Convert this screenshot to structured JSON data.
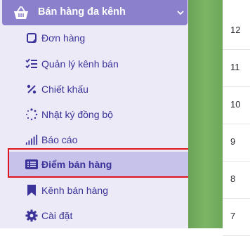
{
  "sidebar": {
    "header": {
      "icon": "basket-icon",
      "title": "Bán hàng đa kênh",
      "chevron": "chevron-down-icon"
    },
    "items": [
      {
        "label": "Đơn hàng",
        "icon": "order-icon"
      },
      {
        "label": "Quản lý kênh bán",
        "icon": "checklist-icon"
      },
      {
        "label": "Chiết khấu",
        "icon": "percent-icon"
      },
      {
        "label": "Nhật ký đồng bộ",
        "icon": "sync-log-icon"
      },
      {
        "label": "Báo cáo",
        "icon": "bar-chart-icon"
      },
      {
        "label": "Điểm bán hàng",
        "icon": "list-icon",
        "active": true
      },
      {
        "label": "Kênh bán hàng",
        "icon": "bookmark-icon"
      },
      {
        "label": "Cài đặt",
        "icon": "gear-icon"
      }
    ]
  },
  "table": {
    "values": [
      "12",
      "11",
      "10",
      "9",
      "8",
      "7"
    ]
  },
  "colors": {
    "header_bg": "#8a80cc",
    "sidebar_bg": "#eceaf7",
    "active_bg": "#c6c2ea",
    "text": "#3b3399",
    "highlight": "#e0141b"
  }
}
